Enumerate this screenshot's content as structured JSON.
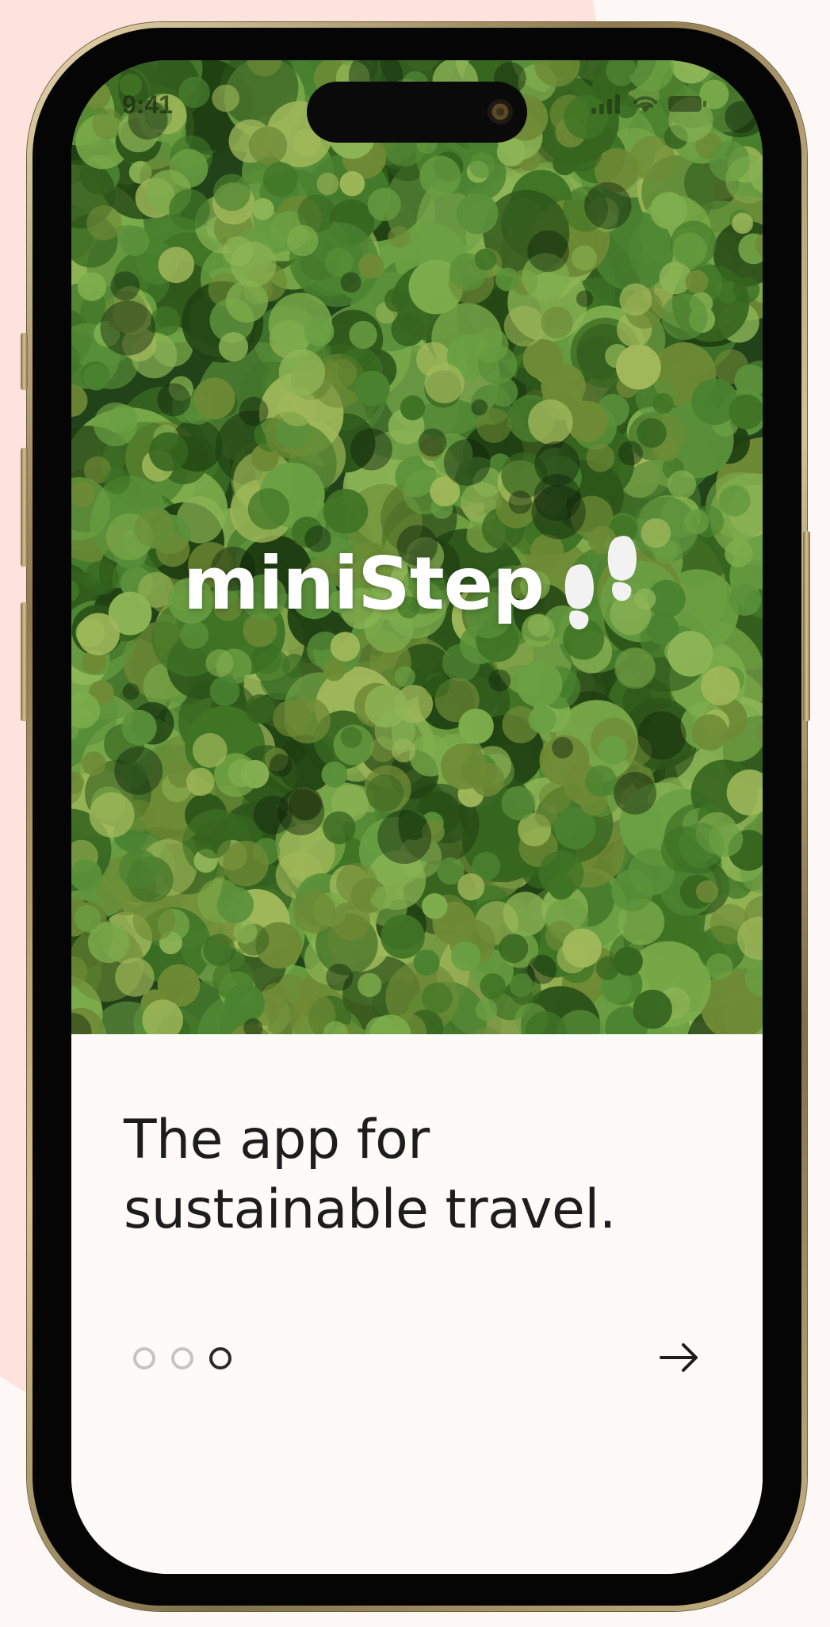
{
  "status_bar": {
    "time": "9:41"
  },
  "brand": {
    "name": "miniStep",
    "logo_icon": "footprints-icon"
  },
  "onboarding": {
    "headline_line1": "The app for",
    "headline_line2": "sustainable travel.",
    "page_count": 3,
    "current_page": 3,
    "next_icon": "arrow-right-icon"
  },
  "colors": {
    "background_pink": "#fde3de",
    "card_background": "#fdfaf7",
    "text_dark": "#1d1d1d",
    "dot_inactive": "#c4c4c4",
    "forest_green": "#3f6f23"
  }
}
